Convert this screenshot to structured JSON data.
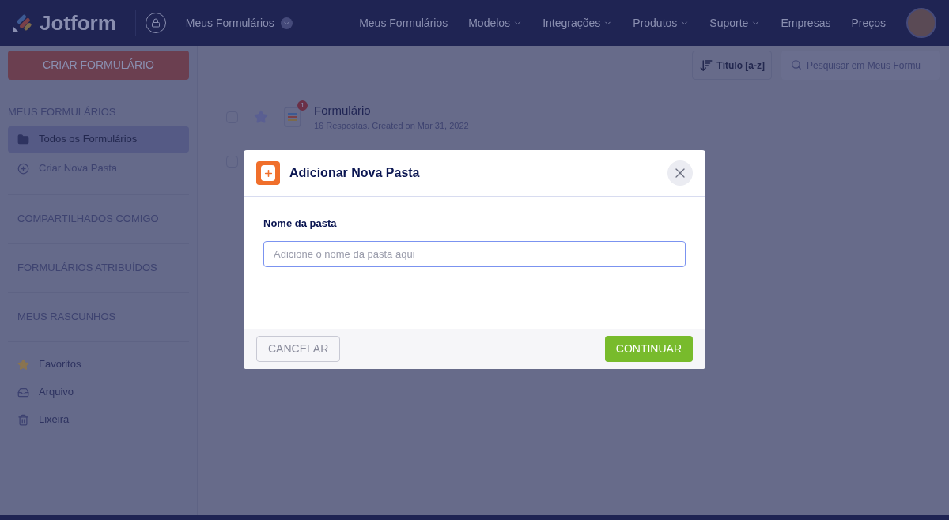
{
  "topbar": {
    "logo": "Jotform",
    "breadcrumb": "Meus Formulários",
    "nav": [
      {
        "label": "Meus Formulários",
        "dropdown": false
      },
      {
        "label": "Modelos",
        "dropdown": true
      },
      {
        "label": "Integrações",
        "dropdown": true
      },
      {
        "label": "Produtos",
        "dropdown": true
      },
      {
        "label": "Suporte",
        "dropdown": true
      },
      {
        "label": "Empresas",
        "dropdown": false
      },
      {
        "label": "Preços",
        "dropdown": false
      }
    ]
  },
  "sidebar": {
    "create_button": "CRIAR FORMULÁRIO",
    "heading": "MEUS FORMULÁRIOS",
    "items": [
      {
        "label": "Todos os Formulários",
        "kind": "folder",
        "selected": true
      },
      {
        "label": "Criar Nova Pasta",
        "kind": "add",
        "selected": false
      }
    ],
    "sections": [
      "COMPARTILHADOS COMIGO",
      "FORMULÁRIOS ATRIBUÍDOS",
      "MEUS RASCUNHOS"
    ],
    "bottom_items": [
      {
        "label": "Favoritos",
        "kind": "star"
      },
      {
        "label": "Arquivo",
        "kind": "archive"
      },
      {
        "label": "Lixeira",
        "kind": "trash"
      }
    ]
  },
  "toolbar": {
    "sort": "Título [a-z]",
    "search": {
      "placeholder": "Pesquisar em Meus Formu"
    }
  },
  "forms": [
    {
      "title": "Formulário",
      "subtitle": "16 Respostas. Created on Mar 31, 2022",
      "badge": "1",
      "checked": false,
      "starred": false
    },
    {
      "checked": false
    }
  ],
  "dialog": {
    "title": "Adicionar Nova Pasta",
    "field_label": "Nome da pasta",
    "field": {
      "placeholder": "Adicione o nome da pasta aqui"
    },
    "cancel": "CANCELAR",
    "continue": "CONTINUAR"
  }
}
